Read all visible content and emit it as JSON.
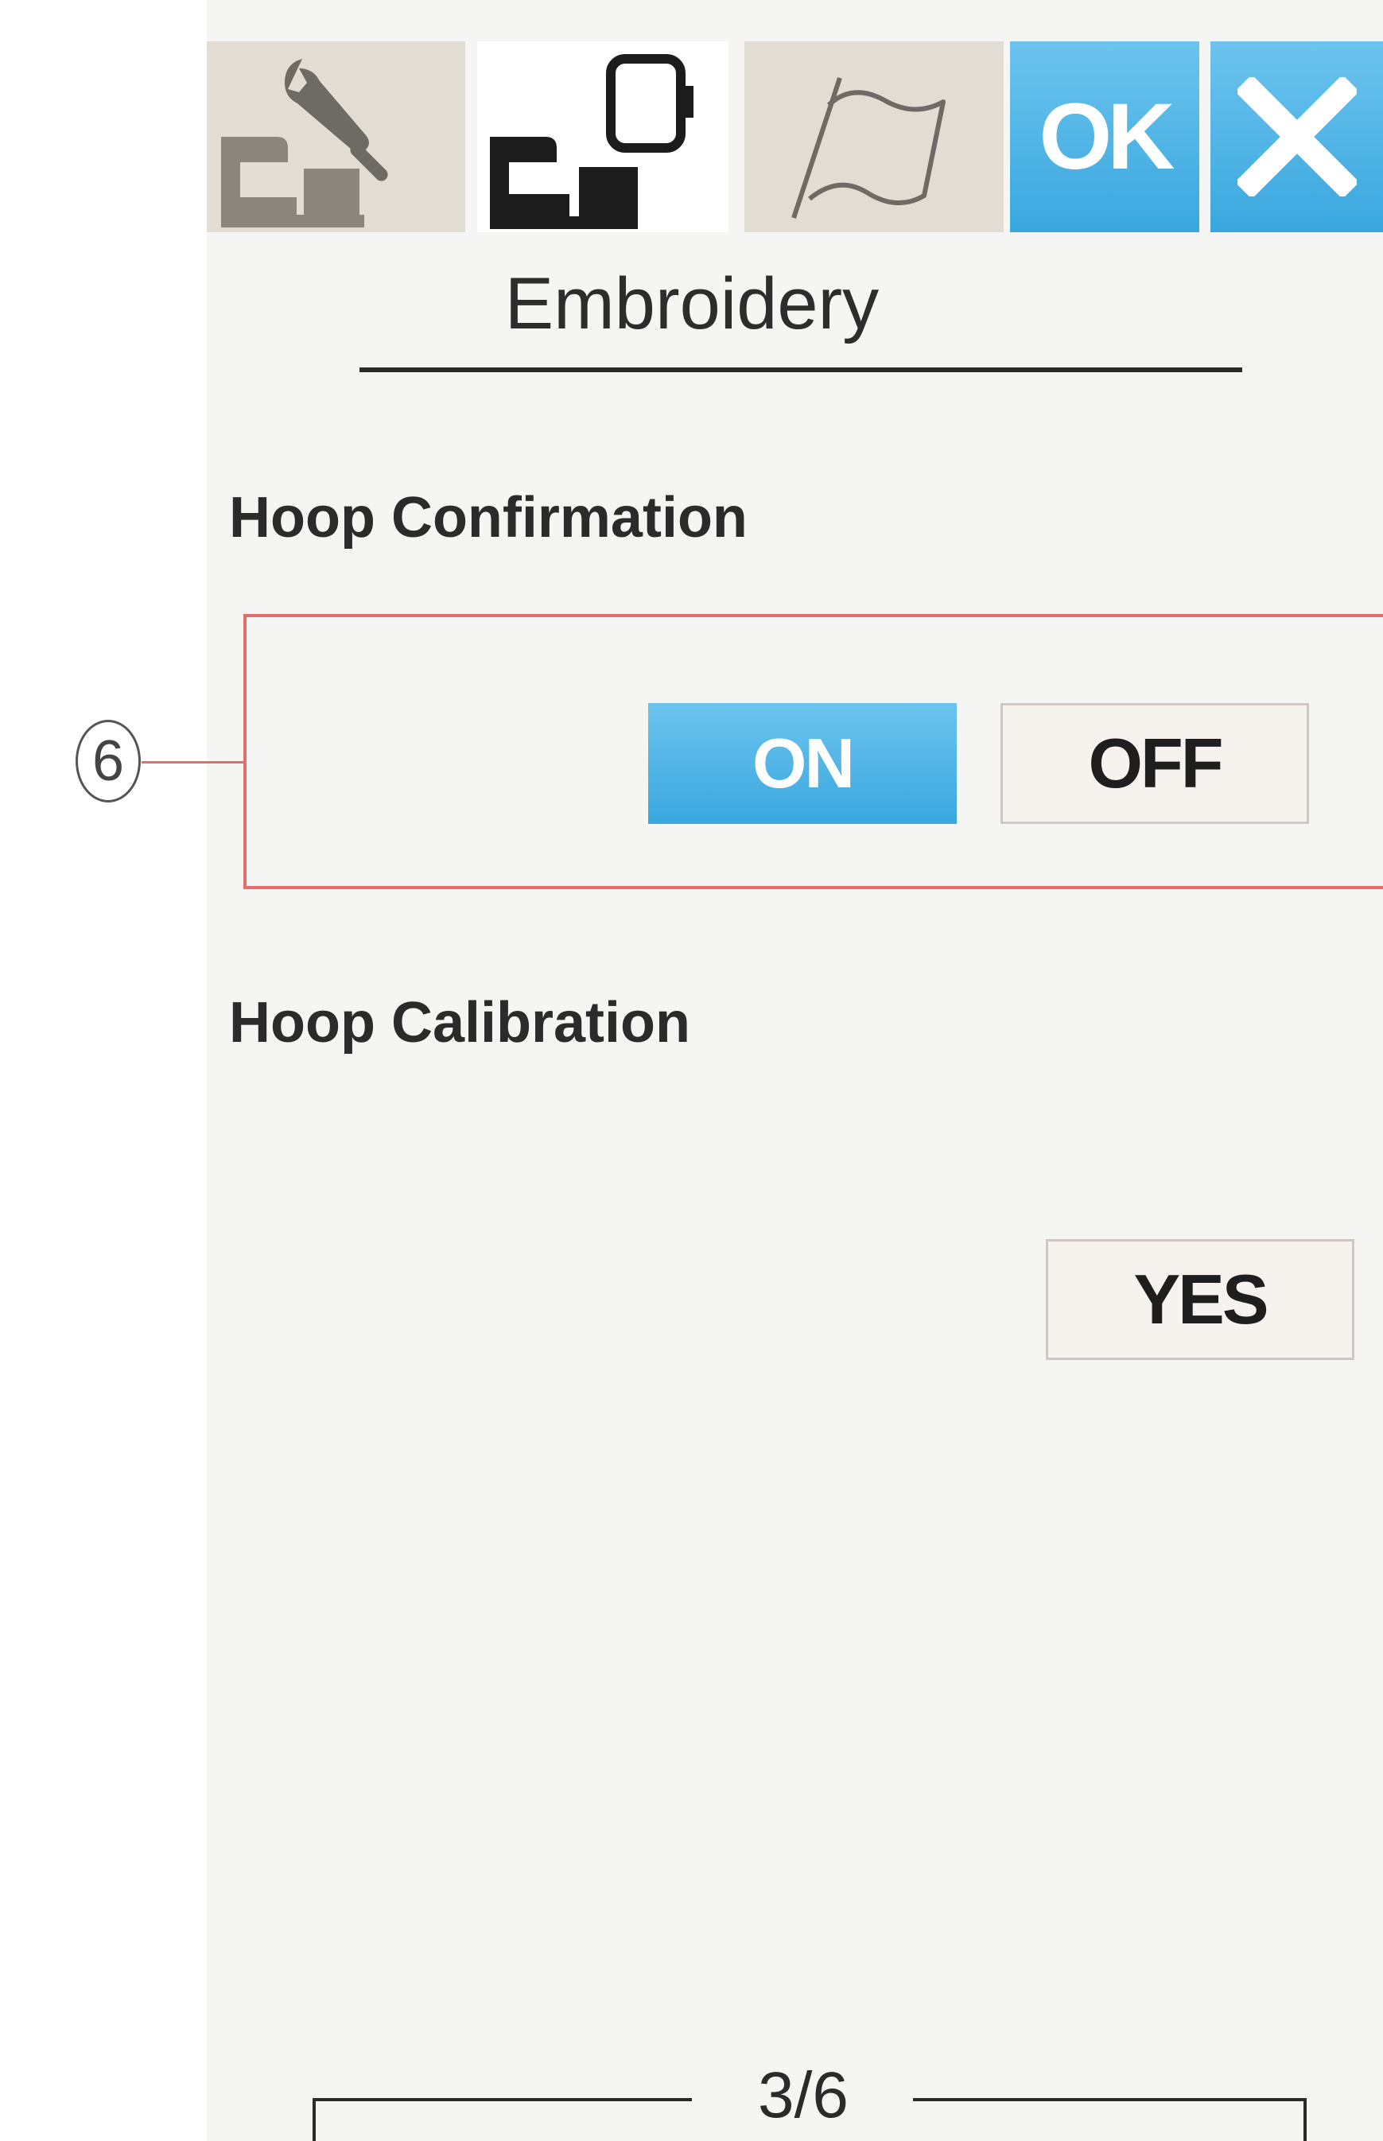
{
  "toolbar": {
    "tabs": [
      {
        "name": "machine-settings",
        "icon": "wrench-sewing-machine-icon",
        "active": false
      },
      {
        "name": "embroidery-settings",
        "icon": "embroidery-machine-hoop-icon",
        "active": true
      },
      {
        "name": "language-settings",
        "icon": "flag-icon",
        "active": false
      }
    ],
    "ok_label": "OK",
    "close_icon": "close-icon"
  },
  "page": {
    "title": "Embroidery"
  },
  "hoop_confirmation": {
    "heading": "Hoop Confirmation",
    "on_label": "ON",
    "off_label": "OFF",
    "selected": "ON"
  },
  "callout": {
    "number": "6"
  },
  "hoop_calibration": {
    "heading": "Hoop Calibration",
    "yes_label": "YES"
  },
  "pager": {
    "text": "3/6"
  },
  "colors": {
    "accent_blue": "#3aa7df",
    "callout_red": "#e66b6b",
    "tab_inactive": "#e2ddd2"
  }
}
